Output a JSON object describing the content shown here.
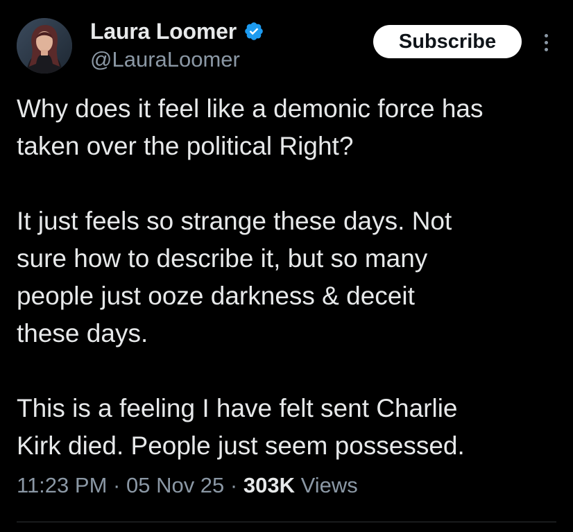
{
  "author": {
    "display_name": "Laura Loomer",
    "handle": "@LauraLoomer",
    "verified": true,
    "verified_icon": "verified-badge-icon",
    "verified_color": "#1d9bf0"
  },
  "actions": {
    "subscribe_label": "Subscribe",
    "more_icon": "more-vertical-icon"
  },
  "post": {
    "paragraphs": [
      "Why does it feel like a demonic force has\ntaken over the political Right?",
      "It just feels so strange these days. Not\nsure how to describe it, but so many\npeople just ooze darkness & deceit\nthese days.",
      "This is a feeling I have felt sent Charlie\nKirk died. People just seem possessed."
    ]
  },
  "meta": {
    "time": "11:23 PM",
    "separator": "·",
    "date": "05 Nov 25",
    "views_count": "303K",
    "views_label": "Views"
  },
  "colors": {
    "background": "#000000",
    "text": "#e7e9ea",
    "secondary": "#8b98a5",
    "divider": "#2f3336",
    "button_bg": "#ffffff",
    "button_text": "#0f1419"
  }
}
